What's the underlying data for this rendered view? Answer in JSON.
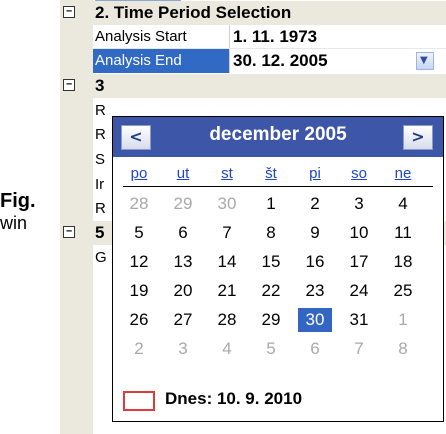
{
  "caption": {
    "fig": "Fig.",
    "win": "win"
  },
  "grid": {
    "cat2_label": "2. Time Period Selection",
    "rows": [
      {
        "name": "Analysis Start",
        "value": "1. 11. 1973"
      },
      {
        "name": "Analysis End",
        "value": "30. 12. 2005"
      }
    ],
    "cat3_label": "3",
    "row_letters": [
      "R",
      "R",
      "S",
      "Ir",
      "R"
    ],
    "cat5_label": "5",
    "last_letter": "G"
  },
  "calendar": {
    "month_label": "december 2005",
    "prev_glyph": "<",
    "next_glyph": ">",
    "weekdays": [
      "po",
      "ut",
      "st",
      "št",
      "pi",
      "so",
      "ne"
    ],
    "weeks": [
      [
        {
          "d": "28",
          "other": true
        },
        {
          "d": "29",
          "other": true
        },
        {
          "d": "30",
          "other": true
        },
        {
          "d": "1"
        },
        {
          "d": "2"
        },
        {
          "d": "3"
        },
        {
          "d": "4"
        }
      ],
      [
        {
          "d": "5"
        },
        {
          "d": "6"
        },
        {
          "d": "7"
        },
        {
          "d": "8"
        },
        {
          "d": "9"
        },
        {
          "d": "10"
        },
        {
          "d": "11"
        }
      ],
      [
        {
          "d": "12"
        },
        {
          "d": "13"
        },
        {
          "d": "14"
        },
        {
          "d": "15"
        },
        {
          "d": "16"
        },
        {
          "d": "17"
        },
        {
          "d": "18"
        }
      ],
      [
        {
          "d": "19"
        },
        {
          "d": "20"
        },
        {
          "d": "21"
        },
        {
          "d": "22"
        },
        {
          "d": "23"
        },
        {
          "d": "24"
        },
        {
          "d": "25"
        }
      ],
      [
        {
          "d": "26"
        },
        {
          "d": "27"
        },
        {
          "d": "28"
        },
        {
          "d": "29"
        },
        {
          "d": "30",
          "selected": true
        },
        {
          "d": "31"
        },
        {
          "d": "1",
          "other": true
        }
      ],
      [
        {
          "d": "2",
          "other": true
        },
        {
          "d": "3",
          "other": true
        },
        {
          "d": "4",
          "other": true
        },
        {
          "d": "5",
          "other": true
        },
        {
          "d": "6",
          "other": true
        },
        {
          "d": "7",
          "other": true
        },
        {
          "d": "8",
          "other": true
        }
      ]
    ],
    "today_label": "Dnes: 10. 9. 2010"
  },
  "colors": {
    "header_bg": "#3e56a8",
    "selected_bg": "#3265c4",
    "today_marker": "#e03a3a",
    "weekday_text": "#1e46c8"
  }
}
